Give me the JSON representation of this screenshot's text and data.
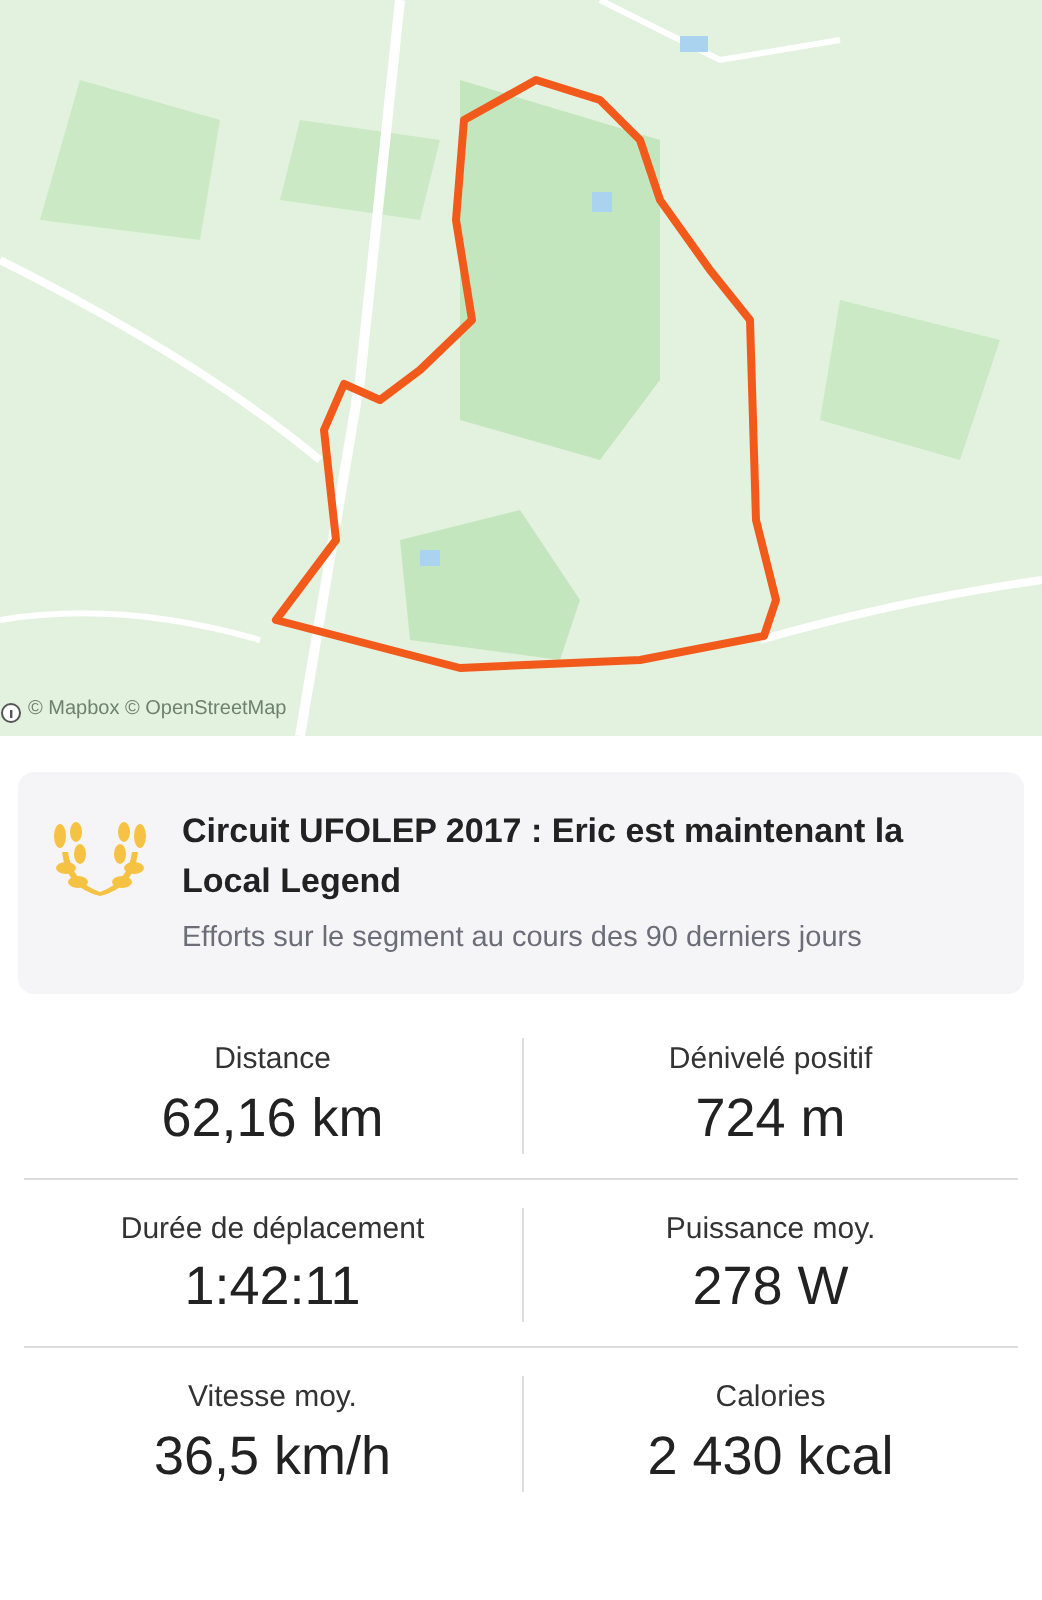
{
  "map": {
    "attribution": "© Mapbox © OpenStreetMap"
  },
  "legend_card": {
    "title": "Circuit UFOLEP 2017 : Eric est maintenant la Local Legend",
    "subtitle": "Efforts sur le segment au cours des 90 derniers jours"
  },
  "stats": [
    {
      "label": "Distance",
      "value": "62,16 km"
    },
    {
      "label": "Dénivelé positif",
      "value": "724 m"
    },
    {
      "label": "Durée de déplacement",
      "value": "1:42:11"
    },
    {
      "label": "Puissance moy.",
      "value": "278 W"
    },
    {
      "label": "Vitesse moy.",
      "value": "36,5 km/h"
    },
    {
      "label": "Calories",
      "value": "2 430 kcal"
    }
  ]
}
